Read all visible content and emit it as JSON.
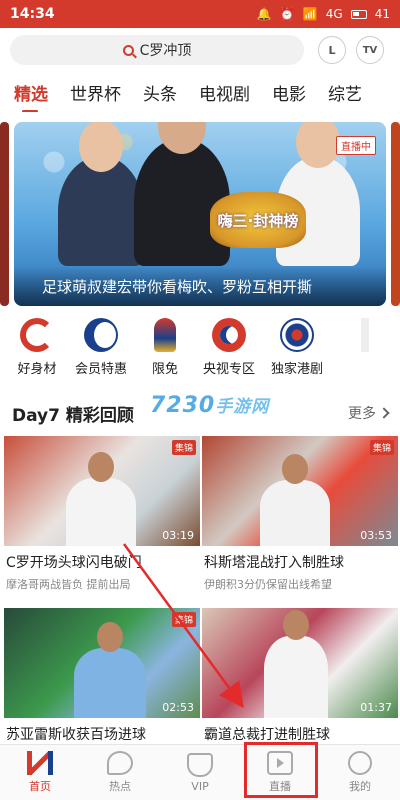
{
  "status_bar": {
    "time": "14:34",
    "network": "4G",
    "battery": "41"
  },
  "search": {
    "placeholder": "C罗冲顶",
    "btn_l": "L",
    "btn_tv": "TV"
  },
  "tabs": [
    "精选",
    "世界杯",
    "头条",
    "电视剧",
    "电影",
    "综艺"
  ],
  "banner": {
    "live_label": "直播中",
    "caption": "足球萌叔建宏带你看梅吹、罗粉互相开撕",
    "logo_text": "嗨三·封神榜"
  },
  "quick_icons": [
    {
      "label": "好身材",
      "icon": "c-logo-icon"
    },
    {
      "label": "会员特惠",
      "icon": "member-icon"
    },
    {
      "label": "限免",
      "icon": "fifa-icon"
    },
    {
      "label": "央视专区",
      "icon": "cctv-icon"
    },
    {
      "label": "独家港剧",
      "icon": "ball-icon"
    }
  ],
  "section": {
    "title": "Day7 精彩回顾",
    "more": "更多"
  },
  "watermark": {
    "main": "7230",
    "sub": "手游网"
  },
  "videos": [
    {
      "tag": "集锦",
      "duration": "03:19",
      "title": "C罗开场头球闪电破门",
      "subtitle": "摩洛哥两战皆负  提前出局"
    },
    {
      "tag": "集锦",
      "duration": "03:53",
      "title": "科斯塔混战打入制胜球",
      "subtitle": "伊朗积3分仍保留出线希望"
    },
    {
      "tag": "集锦",
      "duration": "02:53",
      "title": "苏亚雷斯收获百场进球",
      "subtitle": ""
    },
    {
      "tag": "",
      "duration": "01:37",
      "title": "霸道总裁打进制胜球",
      "subtitle": ""
    }
  ],
  "bottom_nav": [
    {
      "label": "首页",
      "active": true
    },
    {
      "label": "热点",
      "active": false
    },
    {
      "label": "VIP",
      "active": false
    },
    {
      "label": "直播",
      "active": false
    },
    {
      "label": "我的",
      "active": false
    }
  ],
  "colors": {
    "brand": "#d33a2c",
    "accent_blue": "#1a3f8c",
    "annotation": "#e32b2b"
  }
}
